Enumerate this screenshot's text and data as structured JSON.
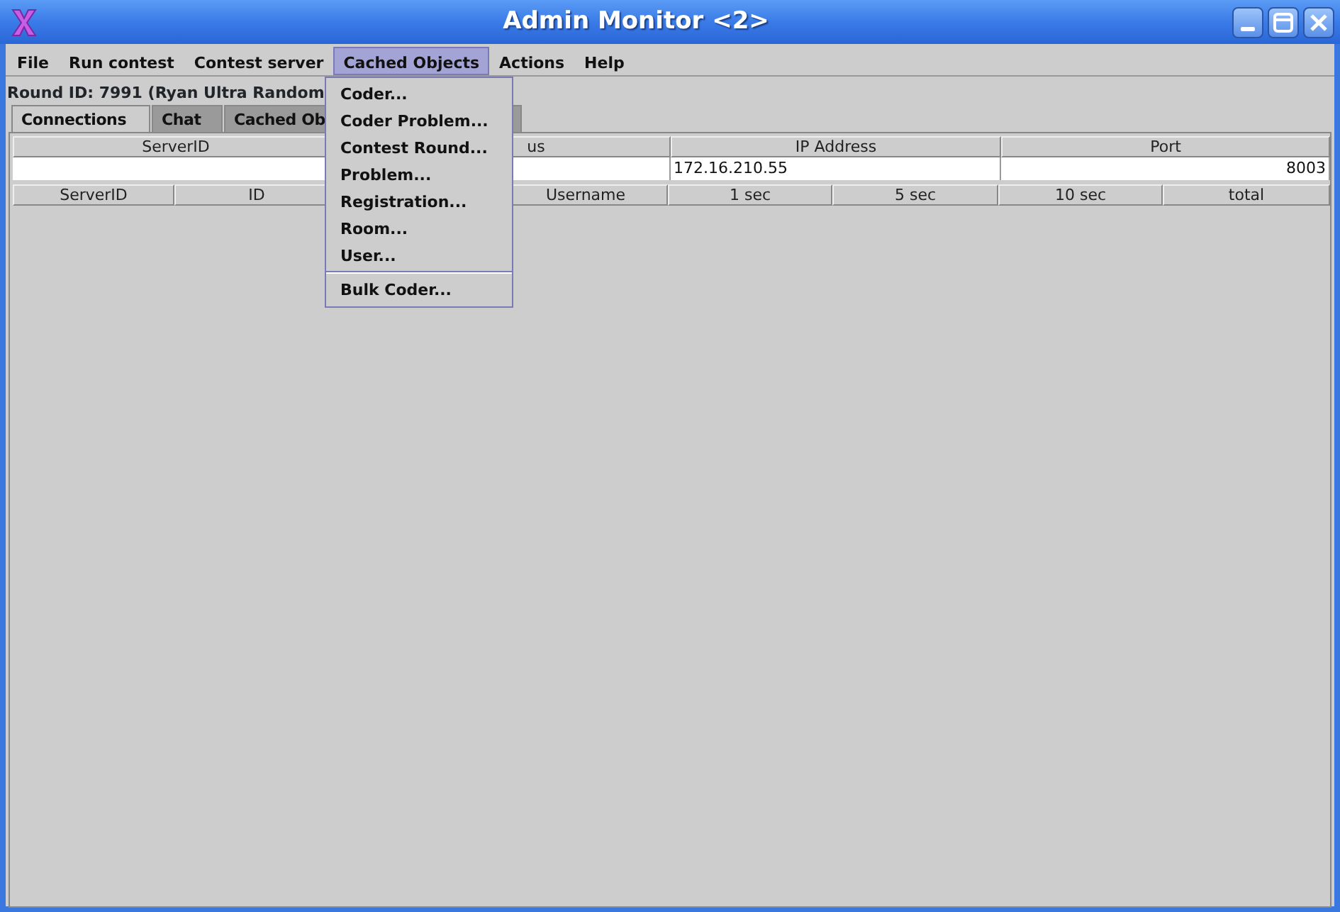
{
  "window": {
    "title": "Admin Monitor <2>"
  },
  "menu_bar": [
    {
      "label": "File",
      "selected": false
    },
    {
      "label": "Run contest",
      "selected": false
    },
    {
      "label": "Contest server",
      "selected": false
    },
    {
      "label": "Cached Objects",
      "selected": true
    },
    {
      "label": "Actions",
      "selected": false
    },
    {
      "label": "Help",
      "selected": false
    }
  ],
  "round_info": "Round ID: 7991 (Ryan Ultra Random",
  "tabs": [
    {
      "label": "Connections",
      "selected": true
    },
    {
      "label": "Chat",
      "selected": false
    },
    {
      "label": "Cached Ob",
      "selected": false
    }
  ],
  "servers_table": {
    "columns": [
      "ServerID",
      "us",
      "IP Address",
      "Port"
    ],
    "rows": [
      [
        "",
        "",
        "172.16.210.55",
        "8003"
      ]
    ]
  },
  "connections_table": {
    "columns": [
      "ServerID",
      "ID",
      null,
      "Username",
      "1 sec",
      "5 sec",
      "10 sec",
      "total"
    ]
  },
  "dropdown_menu": {
    "items": [
      {
        "kind": "item",
        "label": "Coder..."
      },
      {
        "kind": "item",
        "label": "Coder Problem..."
      },
      {
        "kind": "item",
        "label": "Contest Round..."
      },
      {
        "kind": "item",
        "label": "Problem..."
      },
      {
        "kind": "item",
        "label": "Registration..."
      },
      {
        "kind": "item",
        "label": "Room..."
      },
      {
        "kind": "item",
        "label": "User..."
      },
      {
        "kind": "separator"
      },
      {
        "kind": "item",
        "label": "Bulk Coder..."
      }
    ]
  }
}
